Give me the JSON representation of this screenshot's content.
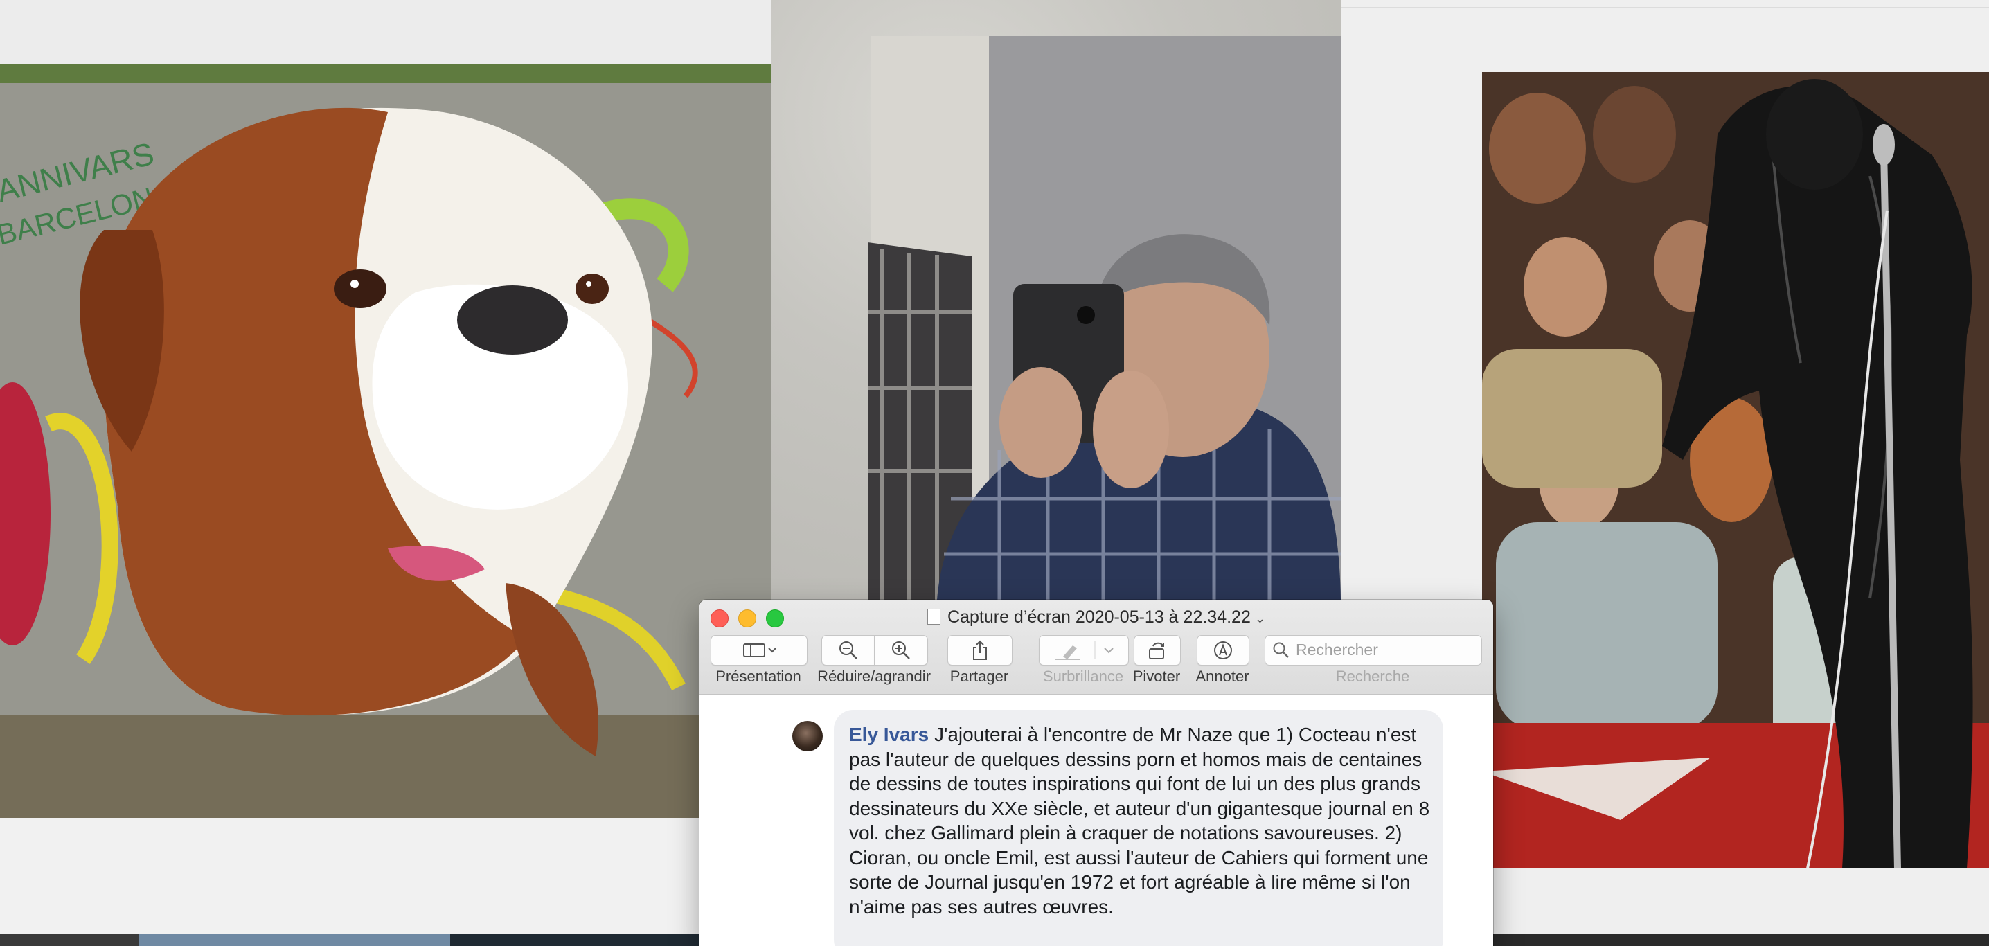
{
  "preview_window": {
    "title": "Capture d’écran 2020-05-13 à 22.34.22",
    "toolbar": {
      "presentation": "Présentation",
      "zoom": "Réduire/agrandir",
      "share": "Partager",
      "highlight": "Surbrillance",
      "rotate": "Pivoter",
      "annotate": "Annoter",
      "search_label": "Recherche",
      "search_placeholder": "Rechercher"
    },
    "traffic_light_colors": [
      "#fe5f57",
      "#febc2e",
      "#28c840"
    ]
  },
  "comment": {
    "author": "Ely Ivars",
    "text": "J'ajouterai à l'encontre de Mr Naze que 1) Cocteau n'est pas l'auteur de quelques dessins porn et homos mais de centaines de dessins de toutes inspirations qui font de lui un des plus grands dessinateurs du XXe siècle, et auteur d'un gigantesque journal en 8 vol. chez Gallimard plein à craquer de notations savoureuses. 2) Cioran, ou oncle Emil, est aussi l'auteur de Cahiers qui forment une sorte de Journal jusqu'en 1972 et fort agréable à lire même si l'on n'aime pas ses autres œuvres.",
    "author_color": "#385898"
  },
  "background_images": {
    "left": "boxer-dog-graffiti",
    "middle": "man-taking-mirror-selfie",
    "right": "singer-in-black-leather-on-stage"
  }
}
